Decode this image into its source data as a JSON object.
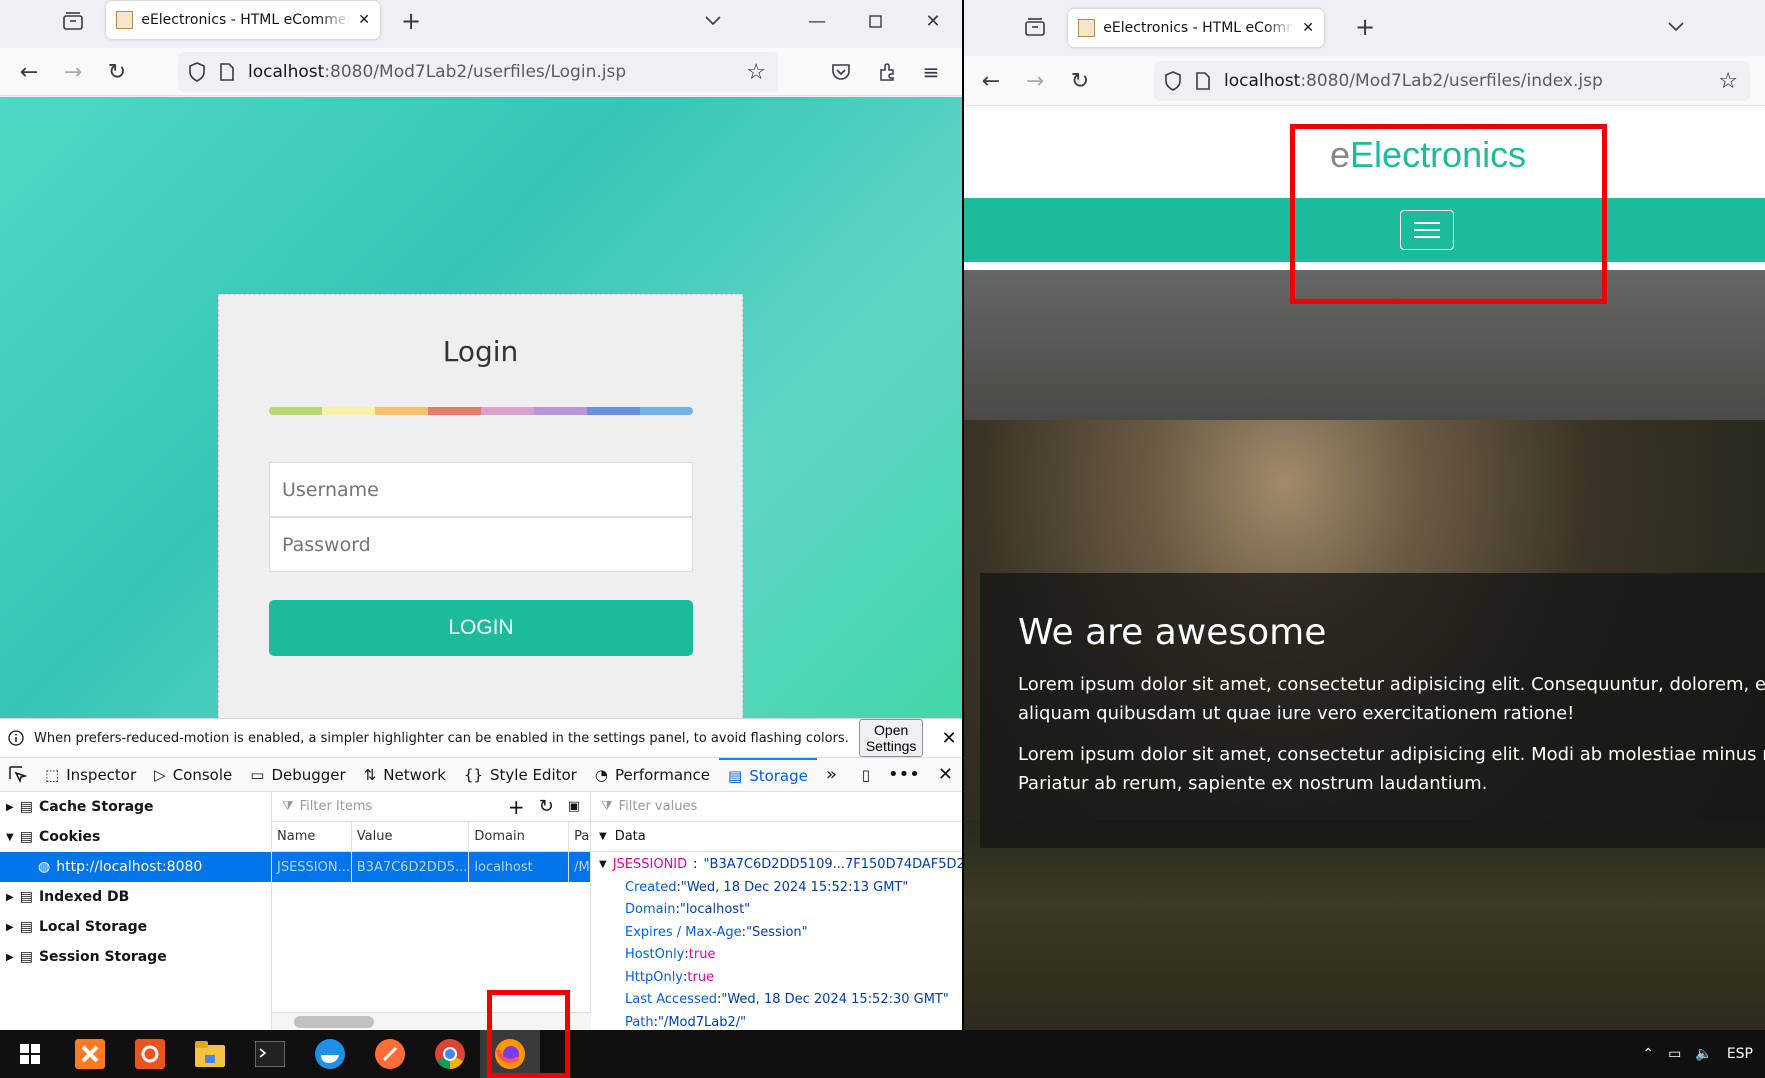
{
  "left_window": {
    "tab_title": "eElectronics - HTML eCommerce Template",
    "url_host": "localhost",
    "url_rest": ":8080/Mod7Lab2/userfiles/Login.jsp"
  },
  "login": {
    "title": "Login",
    "username_placeholder": "Username",
    "password_placeholder": "Password",
    "button_label": "LOGIN",
    "rainbow_colors": [
      "#b6d771",
      "#f6f3a6",
      "#f5c16c",
      "#e97a6a",
      "#d9a0c8",
      "#b795d6",
      "#6b8fe0",
      "#6fb3ea"
    ]
  },
  "devtools": {
    "notice": "When prefers-reduced-motion is enabled, a simpler highlighter can be enabled in the settings panel, to avoid flashing colors.",
    "open_settings": "Open Settings",
    "tabs": [
      "Inspector",
      "Console",
      "Debugger",
      "Network",
      "Style Editor",
      "Performance",
      "Storage"
    ],
    "tree": [
      "Cache Storage",
      "Cookies",
      "http://localhost:8080",
      "Indexed DB",
      "Local Storage",
      "Session Storage"
    ],
    "filter_items": "Filter Items",
    "filter_values": "Filter values",
    "columns": [
      "Name",
      "Value",
      "Domain",
      "Pa"
    ],
    "row": [
      "JSESSION...",
      "B3A7C6D2DD5...",
      "localhost",
      "/M"
    ],
    "data_header": "Data",
    "cookie_name": "JSESSIONID",
    "cookie_value": "\"B3A7C6D2DD5109...7F150D74DAF5D2\"",
    "details": [
      {
        "k": "Created",
        "v": "\"Wed, 18 Dec 2024 15:52:13 GMT\""
      },
      {
        "k": "Domain",
        "v": "\"localhost\""
      },
      {
        "k": "Expires / Max-Age",
        "v": "\"Session\""
      },
      {
        "k": "HostOnly",
        "v": "true"
      },
      {
        "k": "HttpOnly",
        "v": "true"
      },
      {
        "k": "Last Accessed",
        "v": "\"Wed, 18 Dec 2024 15:52:30 GMT\""
      },
      {
        "k": "Path",
        "v": "\"/Mod7Lab2/\""
      }
    ]
  },
  "right_window": {
    "tab_title": "eElectronics - HTML eCommerce Template",
    "url_host": "localhost",
    "url_rest": ":8080/Mod7Lab2/userfiles/index.jsp",
    "logo_e": "e",
    "logo_rest": "Electronics",
    "hero_title": "We are awesome",
    "hero_p1a": "Lorem ipsum dolor sit amet, consectetur adipisicing elit. Consequuntur, dolorem, exceptur",
    "hero_p1b": "aliquam quibusdam ut quae iure vero exercitationem ratione!",
    "hero_p2a": "Lorem ipsum dolor sit amet, consectetur adipisicing elit. Modi ab molestiae minus reicienc",
    "hero_p2b": "Pariatur ab rerum, sapiente ex nostrum laudantium."
  },
  "taskbar": {
    "lang": "ESP"
  },
  "colors": {
    "teal": "#1bbc9b",
    "highlight_red": "#ee0000",
    "devtools_blue": "#0074e8"
  }
}
